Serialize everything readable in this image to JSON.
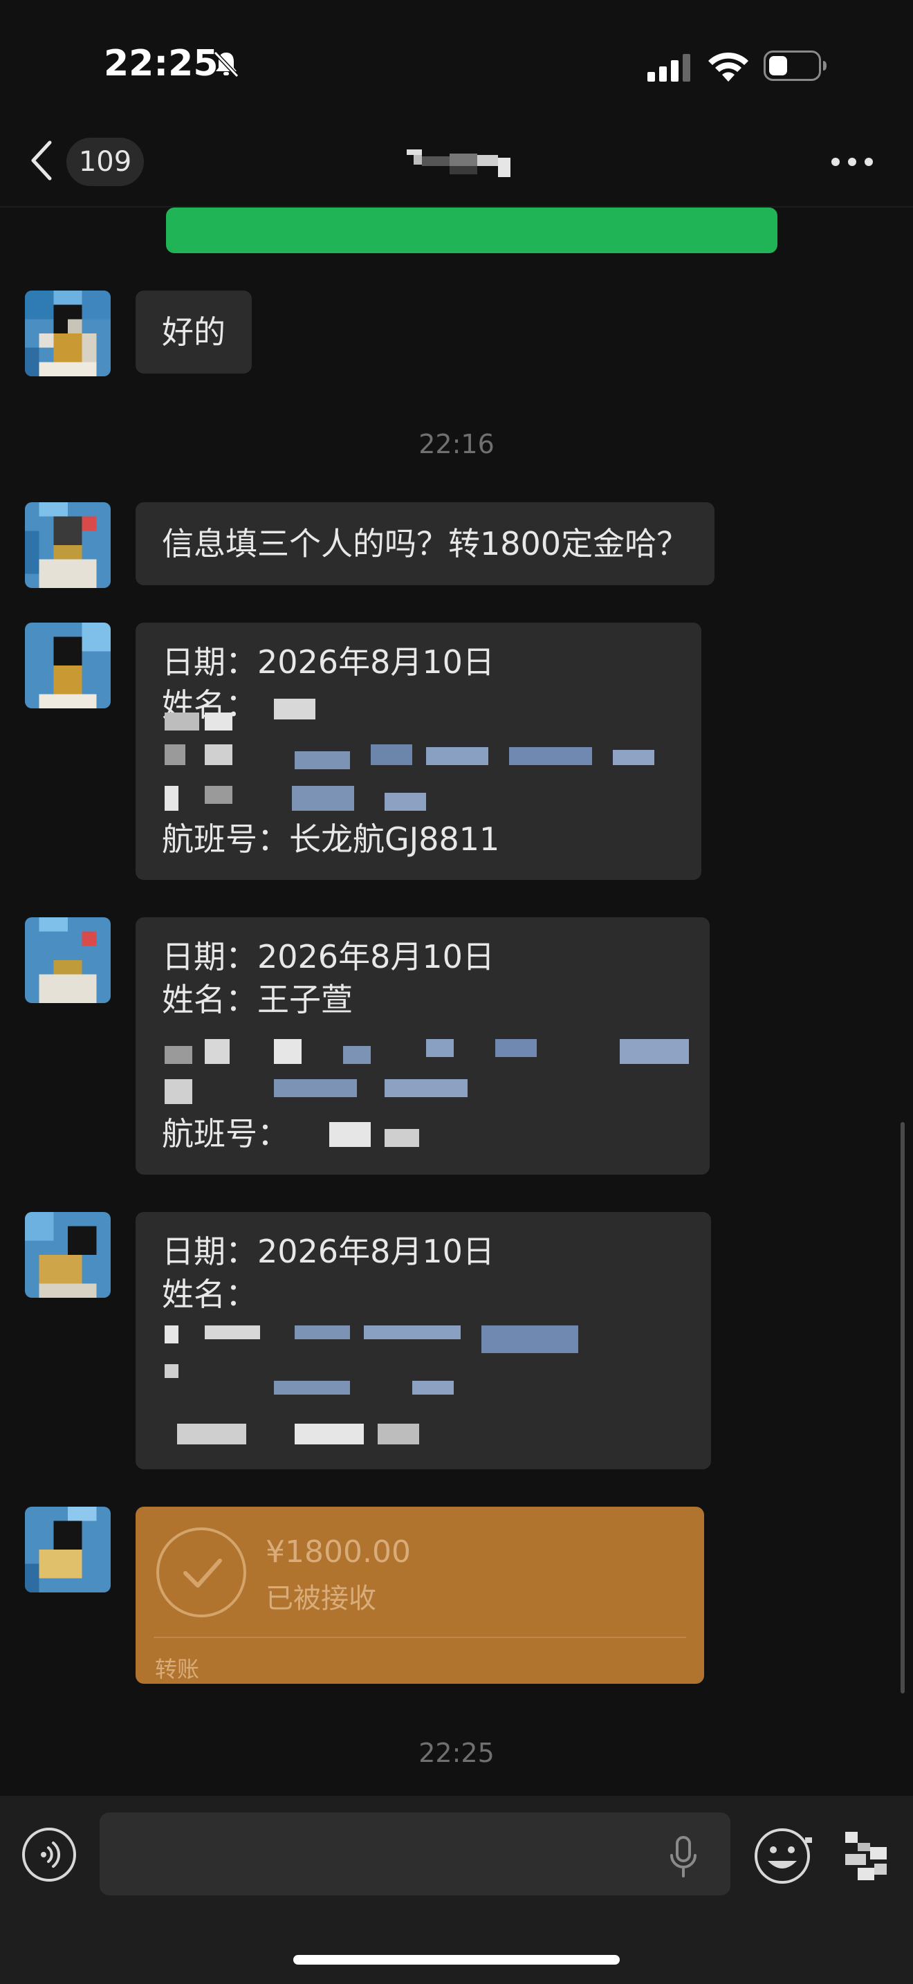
{
  "status_bar": {
    "time": "22:25",
    "icons": [
      "bell-muted-icon",
      "signal-icon",
      "wifi-icon",
      "battery-icon"
    ]
  },
  "nav": {
    "back_count": "109",
    "icons": [
      "back-chevron-icon",
      "more-icon"
    ]
  },
  "messages": [
    {
      "type": "text",
      "text": "好的"
    },
    {
      "type": "timestamp",
      "text": "22:16"
    },
    {
      "type": "text",
      "text": "信息填三个人的吗？转1800定金哈？"
    },
    {
      "type": "card",
      "lines": [
        "日期：2026年8月10日",
        "姓名：",
        "航班号：长龙航GJ8811"
      ]
    },
    {
      "type": "card",
      "lines": [
        "日期：2026年8月10日",
        "姓名：王子萱",
        "航班号："
      ]
    },
    {
      "type": "card",
      "lines": [
        "日期：2026年8月10日",
        "姓名："
      ]
    },
    {
      "type": "transfer",
      "amount": "¥1800.00",
      "status": "已被接收",
      "label": "转账"
    },
    {
      "type": "timestamp",
      "text": "22:25"
    }
  ],
  "colors": {
    "background": "#111111",
    "bubble": "#2c2c2c",
    "green_bubble": "#21b457",
    "transfer": "#b0742f",
    "input_bar": "#1e1e1e"
  },
  "input_bar": {
    "icons": [
      "voice-icon",
      "mic-icon",
      "emoji-icon",
      "plus-icon"
    ]
  }
}
